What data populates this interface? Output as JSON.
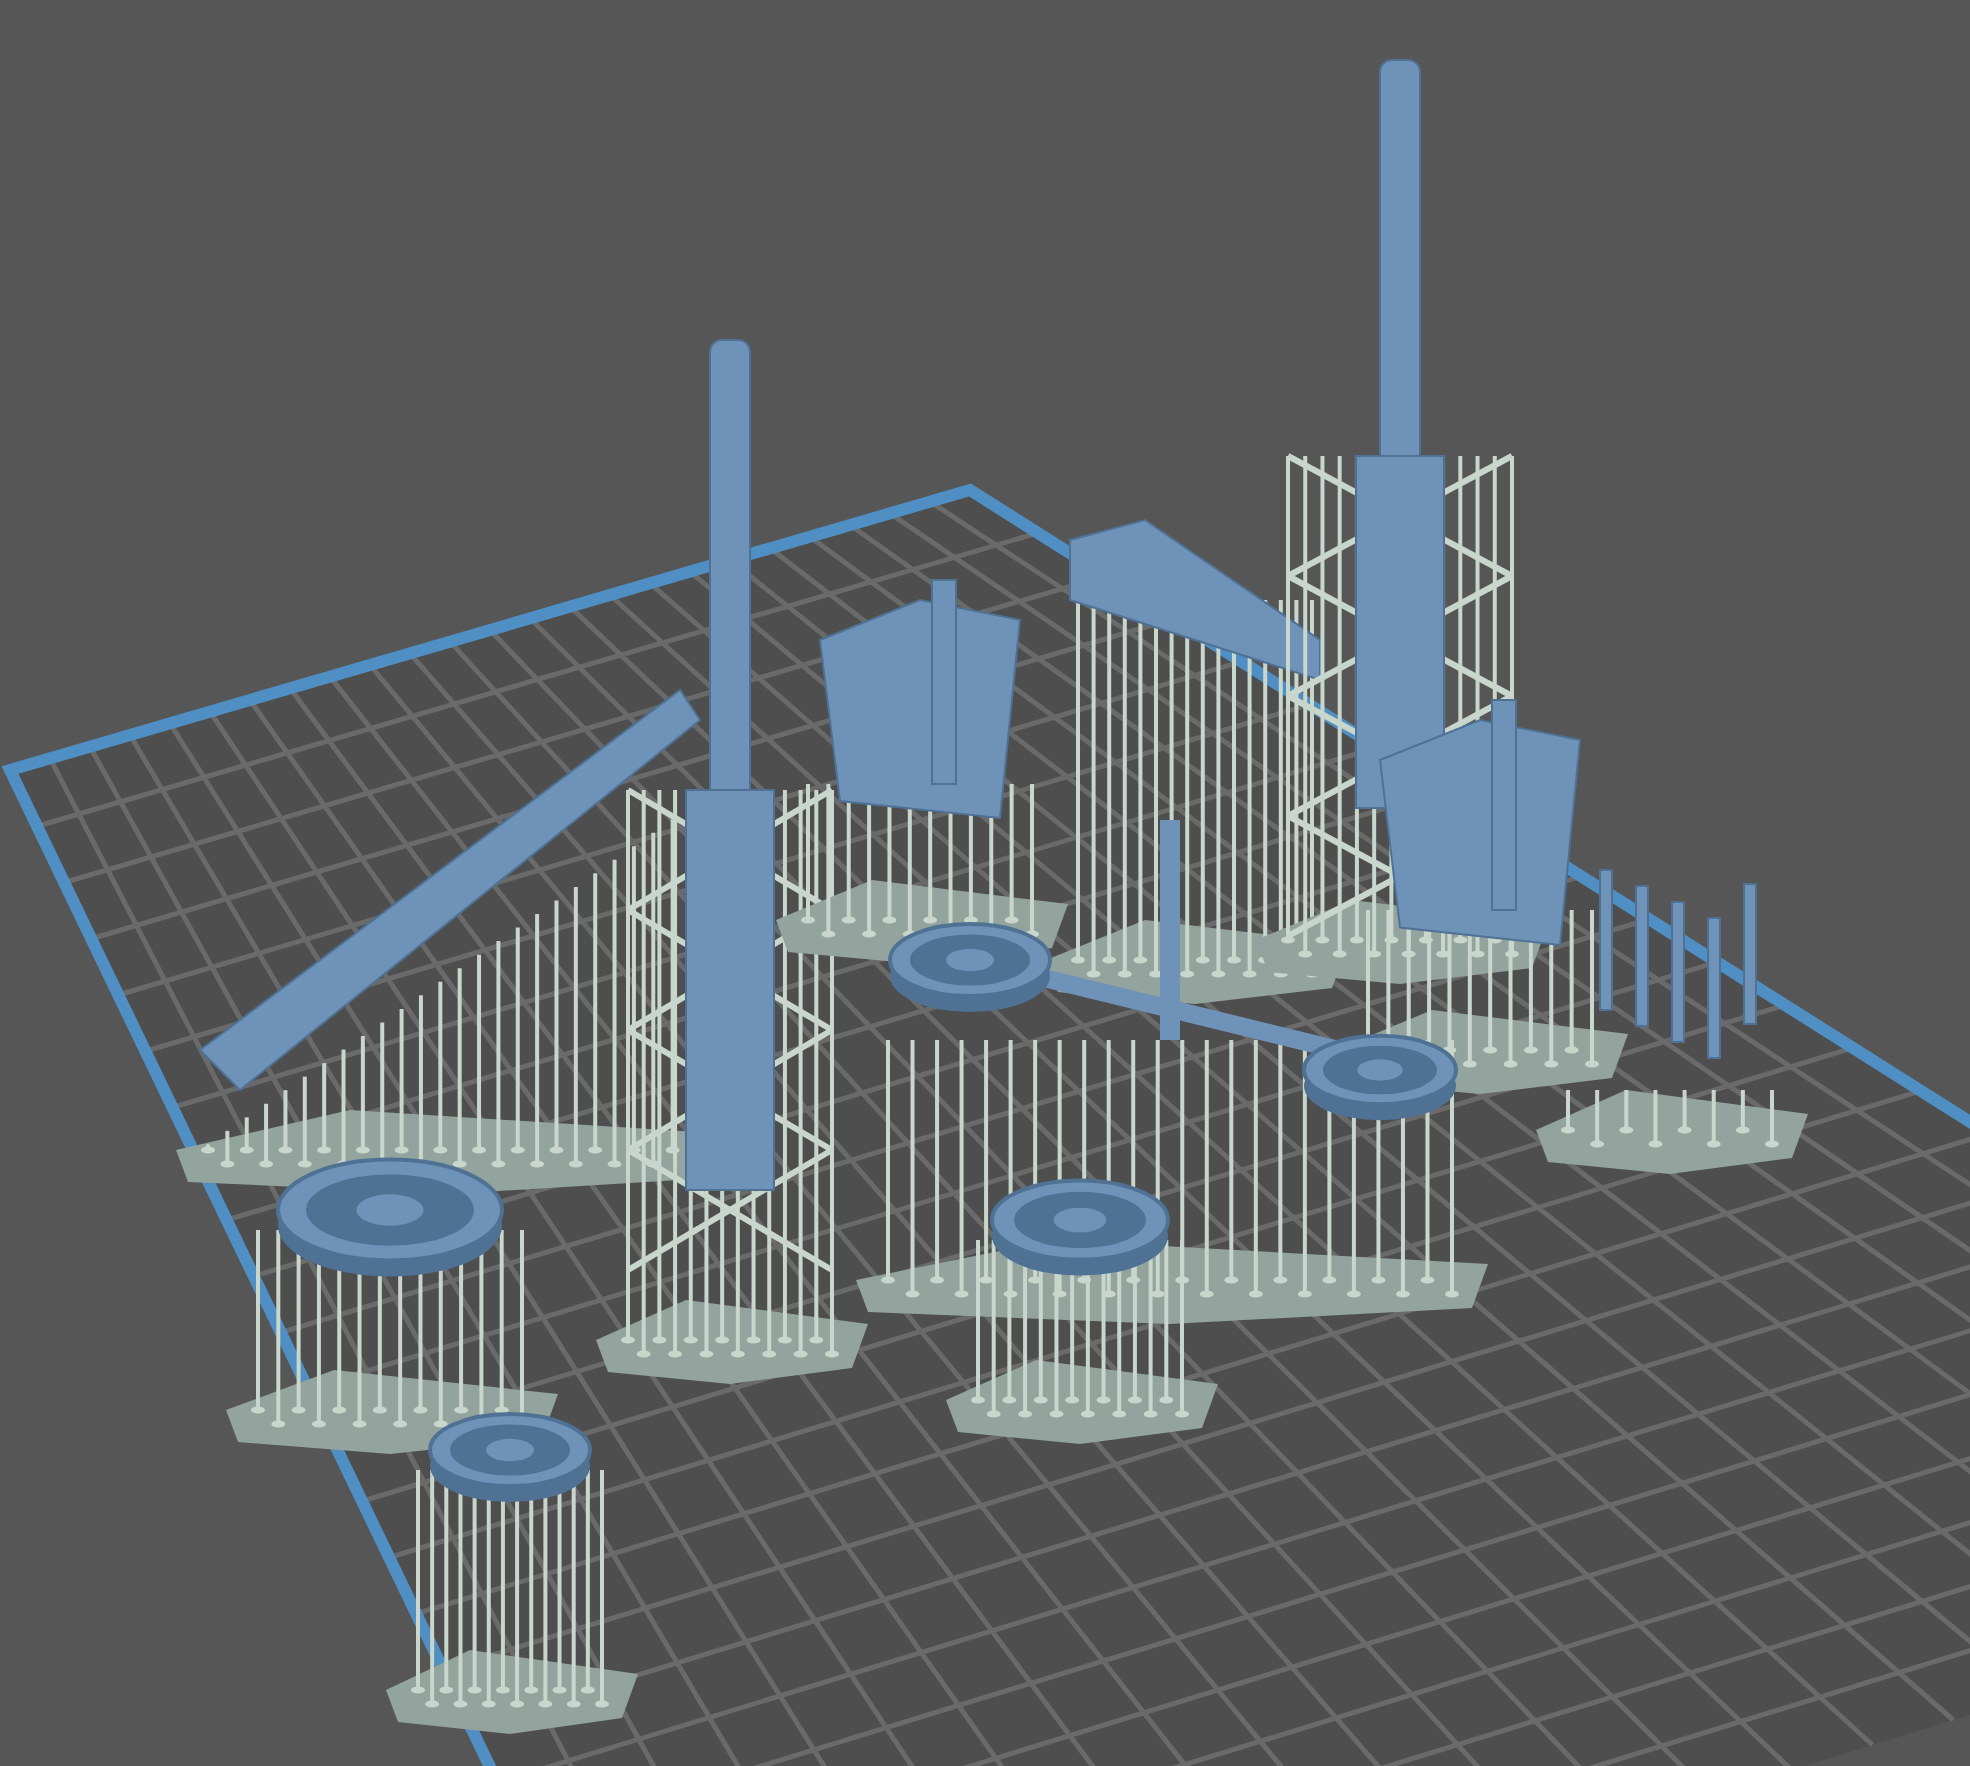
{
  "viewport": {
    "objects": [
      {
        "kind": "trail"
      },
      {
        "kind": "barrel"
      },
      {
        "kind": "carriage"
      },
      {
        "kind": "block"
      },
      {
        "kind": "barrel"
      },
      {
        "kind": "carriage"
      },
      {
        "kind": "axle"
      },
      {
        "kind": "pins"
      },
      {
        "kind": "wheel"
      },
      {
        "kind": "wheel"
      },
      {
        "kind": "wheel"
      }
    ]
  }
}
